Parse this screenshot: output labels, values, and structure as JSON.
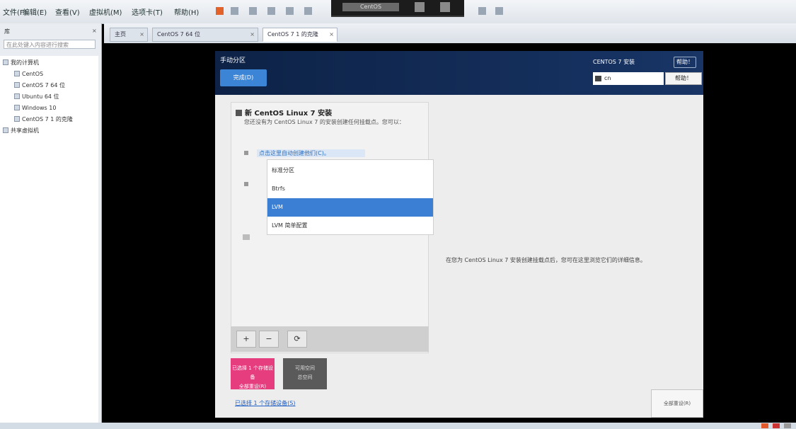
{
  "menubar": {
    "items": [
      "文件(F)",
      "编辑(E)",
      "查看(V)",
      "虚拟机(M)",
      "选项卡(T)",
      "帮助(H)"
    ]
  },
  "overlay": {
    "label": "CentOS"
  },
  "leftpanel": {
    "title": "库",
    "search_placeholder": "在此处键入内容进行搜索",
    "tree": [
      "我的计算机",
      "CentOS",
      "CentOS 7 64 位",
      "Ubuntu 64 位",
      "Windows 10",
      "CentOS 7 1 的克隆",
      "共享虚拟机"
    ]
  },
  "tabs": [
    "主页",
    "CentOS 7 64 位",
    "CentOS 7 1 的克隆"
  ],
  "installer": {
    "title": "手动分区",
    "done": "完成(D)",
    "install_label": "CENTOS 7 安装",
    "help": "帮助！",
    "lang_value": "cn",
    "lang_button": "帮助！",
    "section_title": "新 CentOS Linux 7 安装",
    "section_desc": "您还没有为 CentOS Linux 7 的安装创建任何挂载点。您可以：",
    "addon_title": "点击这里自动创建他们(C)。",
    "dropdown_items": [
      "标准分区",
      "Btrfs",
      "LVM",
      "LVM 简单配置"
    ],
    "dropdown_selected": 2,
    "toolbar": [
      "+",
      "−",
      "⟳"
    ],
    "auto_button": [
      "已选择 1 个存储设备",
      "全部重设(R)"
    ],
    "manual_button": [
      "可用空间",
      "总空间"
    ],
    "bottom_link": "已选择 1 个存储设备(S)",
    "right_info": "在您为 CentOS Linux 7 安装创建挂载点后，您可在这里浏览它们的详细信息。",
    "corner": "全部重设(R)"
  }
}
